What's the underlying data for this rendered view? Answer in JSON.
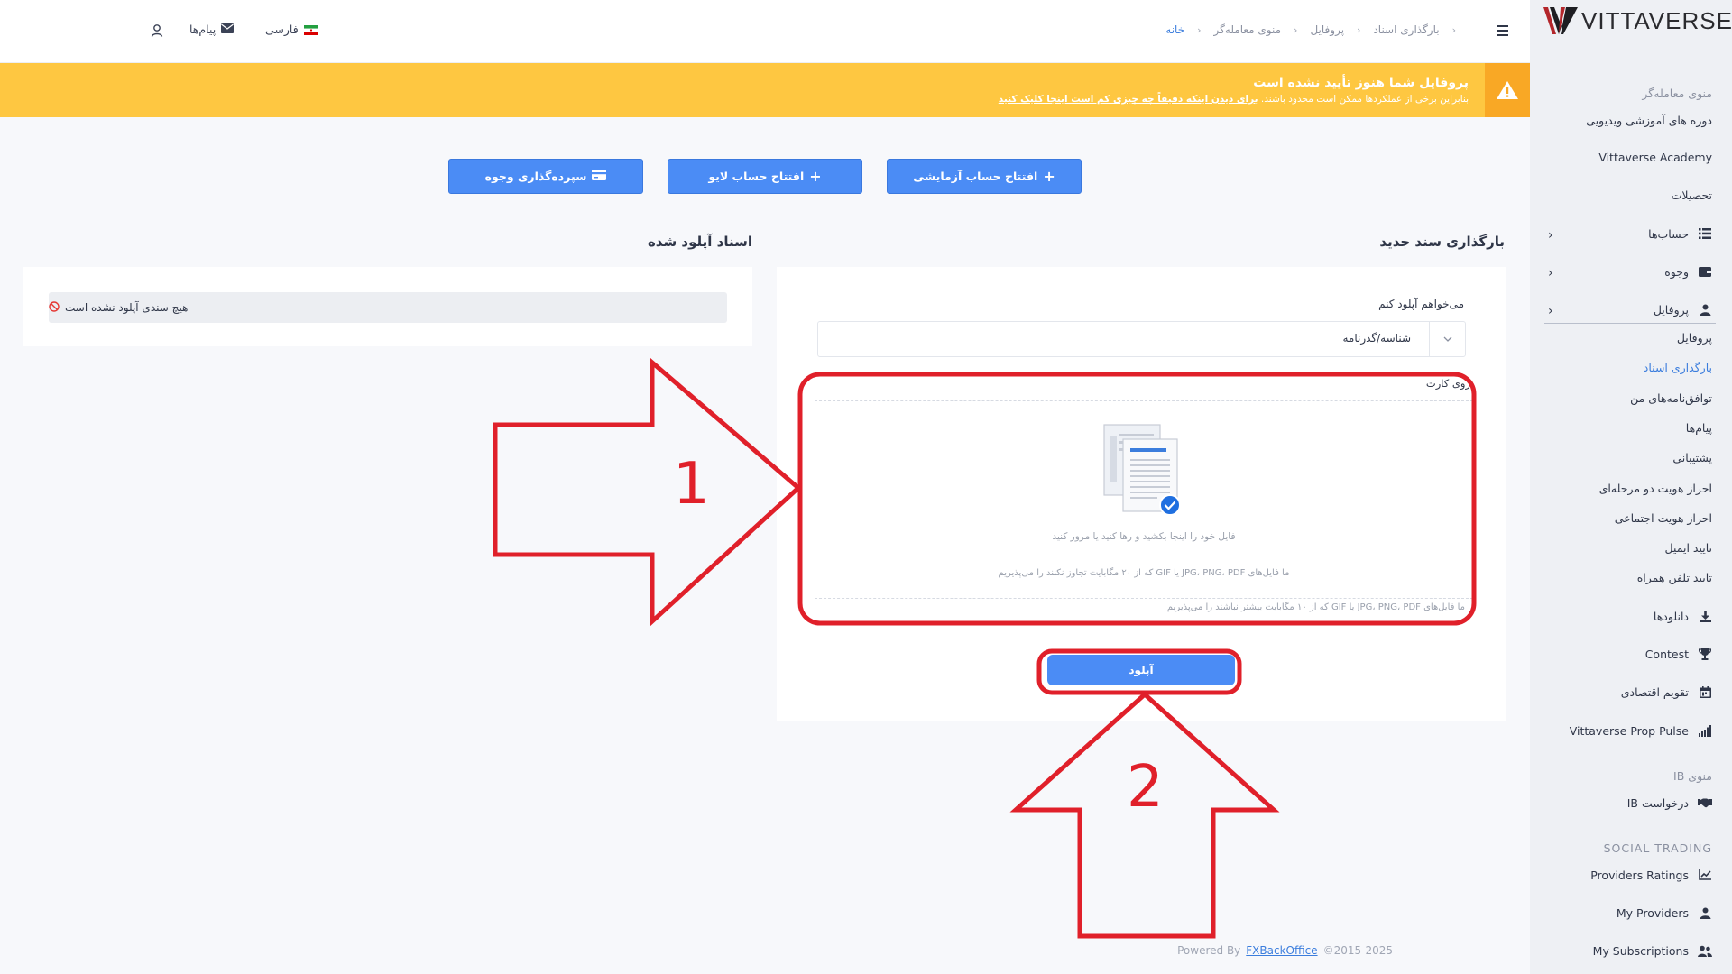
{
  "topbar": {
    "messages": "پیام‌ها",
    "language": "فارسی",
    "breadcrumb": [
      "خانه",
      "منوی معامله‌گر",
      "پروفایل",
      "بارگذاری اسناد"
    ]
  },
  "alert": {
    "title": "پروفایل شما هنوز تأیید نشده است",
    "body": "بنابراین برخی از عملکردها ممکن است محدود باشند.",
    "link": "برای دیدن اینکه دقیقاً چه چیزی کم است اینجا کلیک کنید"
  },
  "actions": {
    "demo": "افتتاح حساب آزمایشی",
    "live": "افتتاح حساب لایو",
    "deposit": "سپرده‌گذاری وجوه"
  },
  "upload": {
    "title": "بارگذاری سند جدید",
    "field_label": "می‌خواهم آپلود کنم",
    "selected": "شناسه/گذرنامه",
    "side_label": "روی کارت",
    "drop_text": "فایل خود را اینجا بکشید و رها کنید یا مرور کنید",
    "drop_note": "ما فایل‌های JPG، PNG، PDF یا GIF که از ۲۰ مگابایت تجاوز نکنند را می‌پذیریم",
    "hint": "ما فایل‌های JPG، PNG، PDF یا GIF که از ۱۰ مگابایت بیشتر نباشند را می‌پذیریم",
    "button": "آپلود"
  },
  "docs": {
    "title": "اسناد آپلود شده",
    "empty": "هیچ سندی آپلود نشده است"
  },
  "sidebar": {
    "logo": "VITTAVERSE",
    "trader_menu": "منوی معامله‌گر",
    "items": [
      {
        "label": "دوره های آموزشی ویدیویی"
      },
      {
        "label": "Vittaverse Academy"
      },
      {
        "label": "تحصیلات"
      },
      {
        "label": "حساب‌ها",
        "icon": "list-icon"
      },
      {
        "label": "وجوه",
        "icon": "wallet-icon"
      },
      {
        "label": "پروفایل",
        "icon": "user-icon"
      }
    ],
    "profile_sub": [
      "پروفایل",
      "بارگذاری اسناد",
      "توافق‌نامه‌های من",
      "پیام‌ها",
      "پشتیبانی",
      "احراز هویت دو مرحله‌ای",
      "احراز هویت اجتماعی",
      "تایید ایمیل",
      "تایید تلفن همراه"
    ],
    "tools": [
      {
        "label": "دانلودها",
        "icon": "download-icon"
      },
      {
        "label": "Contest",
        "icon": "trophy-icon"
      },
      {
        "label": "تقویم اقتصادی",
        "icon": "calendar-icon"
      },
      {
        "label": "Vittaverse Prop Pulse",
        "icon": "signal-icon"
      }
    ],
    "ib_menu": "منوی IB",
    "ib_request": "درخواست IB",
    "social_trading": "SOCIAL TRADING",
    "social_items": [
      {
        "label": "Providers Ratings",
        "icon": "chart-line-icon"
      },
      {
        "label": "My Providers",
        "icon": "user-icon"
      },
      {
        "label": "My Subscriptions",
        "icon": "users-icon"
      }
    ]
  },
  "footer": {
    "powered": "Powered By",
    "brand": "FXBackOffice",
    "copyright": "©2015-2025"
  },
  "annotations": {
    "step1": "1",
    "step2": "2",
    "color": "#e0202a"
  }
}
